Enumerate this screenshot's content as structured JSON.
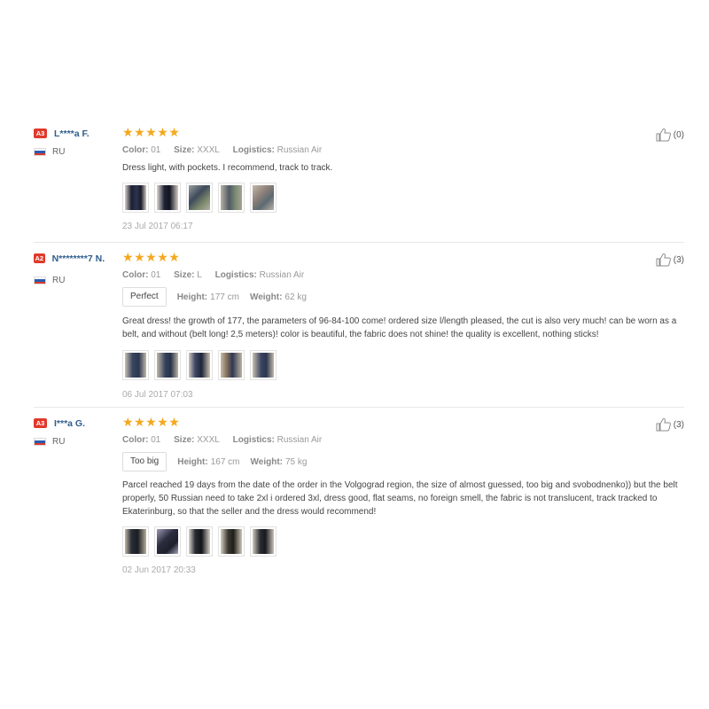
{
  "reviews": [
    {
      "level": "A3",
      "username": "L****a F.",
      "country": "RU",
      "rating": 5,
      "color_label": "Color:",
      "color_value": "01",
      "size_label": "Size:",
      "size_value": "XXXL",
      "logistics_label": "Logistics:",
      "logistics_value": "Russian Air",
      "text": "Dress light, with pockets. I recommend, track to track.",
      "date": "23 Jul 2017 06:17",
      "helpful": "(0)"
    },
    {
      "level": "A2",
      "username": "N********7 N.",
      "country": "RU",
      "rating": 5,
      "color_label": "Color:",
      "color_value": "01",
      "size_label": "Size:",
      "size_value": "L",
      "logistics_label": "Logistics:",
      "logistics_value": "Russian Air",
      "fit": "Perfect",
      "height_label": "Height:",
      "height_value": "177 cm",
      "weight_label": "Weight:",
      "weight_value": "62 kg",
      "text": "Great dress! the growth of 177, the parameters of 96-84-100 come! ordered size l/length pleased, the cut is also very much! can be worn as a belt, and without (belt long! 2,5 meters)! color is beautiful, the fabric does not shine! the quality is excellent, nothing sticks!",
      "date": "06 Jul 2017 07:03",
      "helpful": "(3)"
    },
    {
      "level": "A3",
      "username": "I***a G.",
      "country": "RU",
      "rating": 5,
      "color_label": "Color:",
      "color_value": "01",
      "size_label": "Size:",
      "size_value": "XXXL",
      "logistics_label": "Logistics:",
      "logistics_value": "Russian Air",
      "fit": "Too big",
      "height_label": "Height:",
      "height_value": "167 cm",
      "weight_label": "Weight:",
      "weight_value": "75 kg",
      "text": "Parcel reached 19 days from the date of the order in the Volgograd region, the size of almost guessed, too big and svobodnenko)) but the belt properly, 50 Russian need to take 2xl i ordered 3xl, dress good, flat seams, no foreign smell, the fabric is not translucent, track tracked to Ekaterinburg, so that the seller and the dress would recommend!",
      "date": "02 Jun 2017 20:33",
      "helpful": "(3)"
    }
  ],
  "colors": {
    "badge": "#e0392b",
    "username": "#2f5d8c",
    "star": "#f4a81d"
  },
  "icons": {
    "star": "star-icon",
    "thumb": "thumbs-up-icon",
    "flag": "russia-flag-icon"
  }
}
